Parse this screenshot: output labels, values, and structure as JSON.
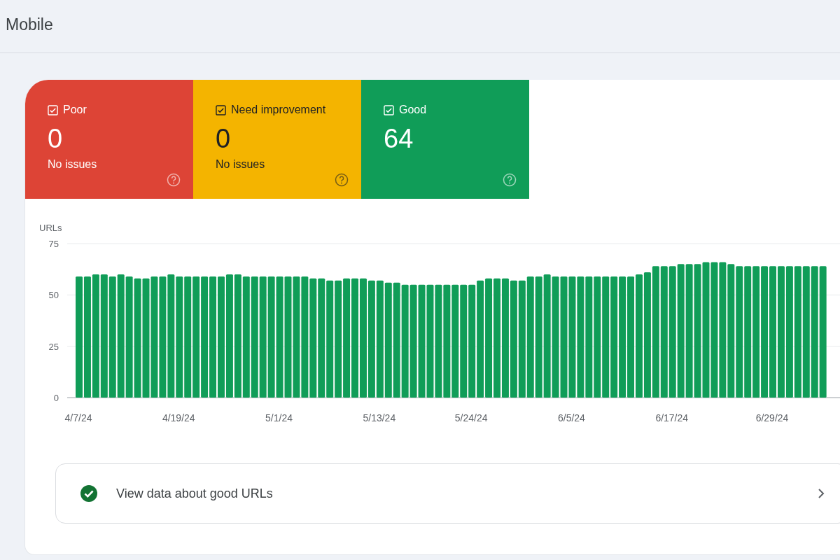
{
  "header": {
    "title": "Mobile"
  },
  "tiles": [
    {
      "label": "Poor",
      "checked": true,
      "value": "0",
      "caption": "No issues",
      "color": "#dd4436"
    },
    {
      "label": "Need improvement",
      "checked": true,
      "value": "0",
      "caption": "No issues",
      "color": "#f4b400"
    },
    {
      "label": "Good",
      "checked": true,
      "value": "64",
      "color": "#109d58"
    }
  ],
  "chart": {
    "chart_data": {
      "type": "bar",
      "ylabel": "URLs",
      "categories": [
        "4/7/24",
        null,
        null,
        null,
        null,
        null,
        null,
        null,
        null,
        null,
        null,
        null,
        "4/19/24",
        null,
        null,
        null,
        null,
        null,
        null,
        null,
        null,
        null,
        null,
        null,
        "5/1/24",
        null,
        null,
        null,
        null,
        null,
        null,
        null,
        null,
        null,
        null,
        null,
        "5/13/24",
        null,
        null,
        null,
        null,
        null,
        null,
        null,
        null,
        null,
        null,
        "5/24/24",
        null,
        null,
        null,
        null,
        null,
        null,
        null,
        null,
        null,
        null,
        null,
        "6/5/24",
        null,
        null,
        null,
        null,
        null,
        null,
        null,
        null,
        null,
        null,
        null,
        "6/17/24",
        null,
        null,
        null,
        null,
        null,
        null,
        null,
        null,
        null,
        null,
        null,
        "6/29/24",
        null,
        null,
        null,
        null,
        null,
        null
      ],
      "series": [
        {
          "color": "#109d58",
          "values": [
            59,
            59,
            60,
            60,
            59,
            60,
            59,
            58,
            58,
            59,
            59,
            60,
            59,
            59,
            59,
            59,
            59,
            59,
            60,
            60,
            59,
            59,
            59,
            59,
            59,
            59,
            59,
            59,
            58,
            58,
            57,
            57,
            58,
            58,
            58,
            57,
            57,
            56,
            56,
            55,
            55,
            55,
            55,
            55,
            55,
            55,
            55,
            55,
            57,
            58,
            58,
            58,
            57,
            57,
            59,
            59,
            60,
            59,
            59,
            59,
            59,
            59,
            59,
            59,
            59,
            59,
            59,
            60,
            61,
            64,
            64,
            64,
            65,
            65,
            65,
            66,
            66,
            66,
            65,
            64,
            64,
            64,
            64,
            64,
            64,
            64,
            64,
            64,
            64,
            64
          ]
        }
      ],
      "ylim": [
        0,
        75
      ],
      "yticks": [
        0,
        25,
        50,
        75
      ]
    }
  },
  "link": {
    "label": "View data about good URLs"
  }
}
